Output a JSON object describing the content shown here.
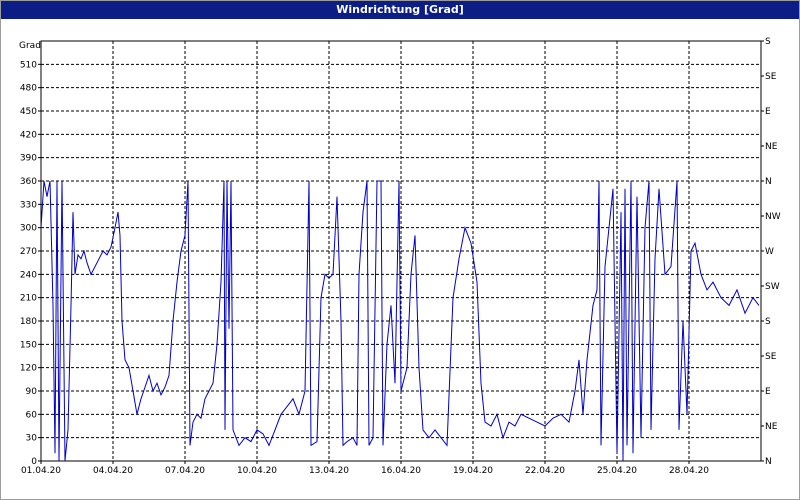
{
  "window": {
    "title": "Windrichtung [Grad]"
  },
  "chart_data": {
    "type": "line",
    "title": "Windrichtung [Grad]",
    "ylabel": "Grad",
    "ylim": [
      0,
      540
    ],
    "xlim": [
      "01.04.20",
      "01.05.20"
    ],
    "y_ticks": [
      0,
      30,
      60,
      90,
      120,
      150,
      180,
      210,
      240,
      270,
      300,
      330,
      360,
      390,
      420,
      450,
      480,
      510
    ],
    "x_ticks": [
      {
        "x": "01.04.20",
        "label": "01.04.20"
      },
      {
        "x": "04.04.20",
        "label": "04.04.20"
      },
      {
        "x": "07.04.20",
        "label": "07.04.20"
      },
      {
        "x": "10.04.20",
        "label": "10.04.20"
      },
      {
        "x": "13.04.20",
        "label": "13.04.20"
      },
      {
        "x": "16.04.20",
        "label": "16.04.20"
      },
      {
        "x": "19.04.20",
        "label": "19.04.20"
      },
      {
        "x": "22.04.20",
        "label": "22.04.20"
      },
      {
        "x": "25.04.20",
        "label": "25.04.20"
      },
      {
        "x": "28.04.20",
        "label": "28.04.20"
      }
    ],
    "right_axis": [
      {
        "y": 0,
        "label": "N"
      },
      {
        "y": 45,
        "label": "NE"
      },
      {
        "y": 90,
        "label": "E"
      },
      {
        "y": 135,
        "label": "SE"
      },
      {
        "y": 180,
        "label": "S"
      },
      {
        "y": 225,
        "label": "SW"
      },
      {
        "y": 270,
        "label": "W"
      },
      {
        "y": 315,
        "label": "NW"
      },
      {
        "y": 360,
        "label": "N"
      },
      {
        "y": 405,
        "label": "NE"
      },
      {
        "y": 450,
        "label": "E"
      },
      {
        "y": 495,
        "label": "SE"
      },
      {
        "y": 540,
        "label": "S"
      }
    ],
    "grid": true,
    "colors": {
      "line": "#0000cc",
      "grid": "#000000",
      "title_bar": "#0c1d86"
    },
    "series": [
      {
        "values": [
          [
            "01.04.20",
            300
          ],
          [
            "01.04.20 03:00",
            360
          ],
          [
            "01.04.20 06:00",
            340
          ],
          [
            "01.04.20 09:00",
            360
          ],
          [
            "01.04.20 12:00",
            200
          ],
          [
            "01.04.20 14:00",
            10
          ],
          [
            "01.04.20 16:00",
            360
          ],
          [
            "01.04.20 18:00",
            0
          ],
          [
            "01.04.20 21:00",
            360
          ],
          [
            "02.04.20",
            0
          ],
          [
            "02.04.20 03:00",
            40
          ],
          [
            "02.04.20 06:00",
            200
          ],
          [
            "02.04.20 08:00",
            320
          ],
          [
            "02.04.20 10:00",
            240
          ],
          [
            "02.04.20 13:00",
            265
          ],
          [
            "02.04.20 16:00",
            260
          ],
          [
            "02.04.20 19:00",
            270
          ],
          [
            "02.04.20 22:00",
            255
          ],
          [
            "03.04.20 02:00",
            240
          ],
          [
            "03.04.20 06:00",
            250
          ],
          [
            "03.04.20 10:00",
            260
          ],
          [
            "03.04.20 14:00",
            270
          ],
          [
            "03.04.20 18:00",
            265
          ],
          [
            "03.04.20 22:00",
            275
          ],
          [
            "04.04.20 02:00",
            300
          ],
          [
            "04.04.20 05:00",
            320
          ],
          [
            "04.04.20 07:00",
            290
          ],
          [
            "04.04.20 09:00",
            180
          ],
          [
            "04.04.20 12:00",
            130
          ],
          [
            "04.04.20 16:00",
            120
          ],
          [
            "04.04.20 20:00",
            90
          ],
          [
            "05.04.20",
            60
          ],
          [
            "05.04.20 04:00",
            80
          ],
          [
            "05.04.20 08:00",
            95
          ],
          [
            "05.04.20 12:00",
            110
          ],
          [
            "05.04.20 16:00",
            90
          ],
          [
            "05.04.20 20:00",
            100
          ],
          [
            "06.04.20",
            85
          ],
          [
            "06.04.20 04:00",
            95
          ],
          [
            "06.04.20 08:00",
            110
          ],
          [
            "06.04.20 12:00",
            180
          ],
          [
            "06.04.20 16:00",
            230
          ],
          [
            "06.04.20 20:00",
            270
          ],
          [
            "07.04.20",
            290
          ],
          [
            "07.04.20 03:00",
            360
          ],
          [
            "07.04.20 05:00",
            20
          ],
          [
            "07.04.20 08:00",
            50
          ],
          [
            "07.04.20 12:00",
            60
          ],
          [
            "07.04.20 16:00",
            55
          ],
          [
            "07.04.20 20:00",
            80
          ],
          [
            "08.04.20",
            90
          ],
          [
            "08.04.20 04:00",
            100
          ],
          [
            "08.04.20 08:00",
            150
          ],
          [
            "08.04.20 12:00",
            230
          ],
          [
            "08.04.20 15:00",
            360
          ],
          [
            "08.04.20 16:00",
            40
          ],
          [
            "08.04.20 18:00",
            360
          ],
          [
            "08.04.20 20:00",
            170
          ],
          [
            "08.04.20 22:00",
            360
          ],
          [
            "09.04.20",
            40
          ],
          [
            "09.04.20 06:00",
            20
          ],
          [
            "09.04.20 12:00",
            30
          ],
          [
            "09.04.20 18:00",
            25
          ],
          [
            "10.04.20",
            40
          ],
          [
            "10.04.20 06:00",
            35
          ],
          [
            "10.04.20 12:00",
            20
          ],
          [
            "10.04.20 18:00",
            40
          ],
          [
            "11.04.20",
            60
          ],
          [
            "11.04.20 06:00",
            70
          ],
          [
            "11.04.20 12:00",
            80
          ],
          [
            "11.04.20 18:00",
            60
          ],
          [
            "12.04.20",
            90
          ],
          [
            "12.04.20 04:00",
            360
          ],
          [
            "12.04.20 06:00",
            20
          ],
          [
            "12.04.20 12:00",
            25
          ],
          [
            "12.04.20 16:00",
            210
          ],
          [
            "12.04.20 20:00",
            240
          ],
          [
            "13.04.20",
            235
          ],
          [
            "13.04.20 04:00",
            240
          ],
          [
            "13.04.20 08:00",
            340
          ],
          [
            "13.04.20 12:00",
            180
          ],
          [
            "13.04.20 14:00",
            20
          ],
          [
            "13.04.20 18:00",
            25
          ],
          [
            "14.04.20",
            30
          ],
          [
            "14.04.20 04:00",
            20
          ],
          [
            "14.04.20 06:00",
            240
          ],
          [
            "14.04.20 10:00",
            320
          ],
          [
            "14.04.20 14:00",
            360
          ],
          [
            "14.04.20 16:00",
            20
          ],
          [
            "14.04.20 20:00",
            30
          ],
          [
            "15.04.20",
            360
          ],
          [
            "15.04.20 04:00",
            360
          ],
          [
            "15.04.20 06:00",
            20
          ],
          [
            "15.04.20 10:00",
            150
          ],
          [
            "15.04.20 14:00",
            200
          ],
          [
            "15.04.20 18:00",
            100
          ],
          [
            "15.04.20 22:00",
            360
          ],
          [
            "16.04.20",
            90
          ],
          [
            "16.04.20 06:00",
            120
          ],
          [
            "16.04.20 10:00",
            240
          ],
          [
            "16.04.20 14:00",
            290
          ],
          [
            "16.04.20 18:00",
            120
          ],
          [
            "16.04.20 22:00",
            40
          ],
          [
            "17.04.20 04:00",
            30
          ],
          [
            "17.04.20 10:00",
            40
          ],
          [
            "17.04.20 16:00",
            30
          ],
          [
            "17.04.20 22:00",
            20
          ],
          [
            "18.04.20 04:00",
            210
          ],
          [
            "18.04.20 10:00",
            260
          ],
          [
            "18.04.20 16:00",
            300
          ],
          [
            "18.04.20 22:00",
            280
          ],
          [
            "19.04.20 04:00",
            230
          ],
          [
            "19.04.20 08:00",
            100
          ],
          [
            "19.04.20 12:00",
            50
          ],
          [
            "19.04.20 18:00",
            45
          ],
          [
            "20.04.20",
            60
          ],
          [
            "20.04.20 06:00",
            30
          ],
          [
            "20.04.20 12:00",
            50
          ],
          [
            "20.04.20 18:00",
            45
          ],
          [
            "21.04.20",
            60
          ],
          [
            "21.04.20 08:00",
            55
          ],
          [
            "21.04.20 16:00",
            50
          ],
          [
            "22.04.20",
            45
          ],
          [
            "22.04.20 08:00",
            55
          ],
          [
            "22.04.20 16:00",
            60
          ],
          [
            "23.04.20",
            50
          ],
          [
            "23.04.20 06:00",
            90
          ],
          [
            "23.04.20 10:00",
            130
          ],
          [
            "23.04.20 14:00",
            60
          ],
          [
            "23.04.20 18:00",
            130
          ],
          [
            "24.04.20",
            200
          ],
          [
            "24.04.20 04:00",
            220
          ],
          [
            "24.04.20 06:00",
            360
          ],
          [
            "24.04.20 08:00",
            20
          ],
          [
            "24.04.20 12:00",
            250
          ],
          [
            "24.04.20 16:00",
            300
          ],
          [
            "24.04.20 20:00",
            350
          ],
          [
            "25.04.20",
            10
          ],
          [
            "25.04.20 04:00",
            320
          ],
          [
            "25.04.20 06:00",
            0
          ],
          [
            "25.04.20 08:00",
            350
          ],
          [
            "25.04.20 10:00",
            20
          ],
          [
            "25.04.20 14:00",
            360
          ],
          [
            "25.04.20 16:00",
            10
          ],
          [
            "25.04.20 20:00",
            340
          ],
          [
            "26.04.20",
            30
          ],
          [
            "26.04.20 04:00",
            300
          ],
          [
            "26.04.20 08:00",
            360
          ],
          [
            "26.04.20 10:00",
            40
          ],
          [
            "26.04.20 14:00",
            260
          ],
          [
            "26.04.20 18:00",
            350
          ],
          [
            "27.04.20",
            240
          ],
          [
            "27.04.20 06:00",
            250
          ],
          [
            "27.04.20 12:00",
            360
          ],
          [
            "27.04.20 14:00",
            40
          ],
          [
            "27.04.20 18:00",
            180
          ],
          [
            "27.04.20 22:00",
            60
          ],
          [
            "28.04.20 02:00",
            270
          ],
          [
            "28.04.20 06:00",
            280
          ],
          [
            "28.04.20 12:00",
            240
          ],
          [
            "28.04.20 18:00",
            220
          ],
          [
            "29.04.20",
            230
          ],
          [
            "29.04.20 08:00",
            210
          ],
          [
            "29.04.20 16:00",
            200
          ],
          [
            "30.04.20",
            220
          ],
          [
            "30.04.20 08:00",
            190
          ],
          [
            "30.04.20 16:00",
            210
          ],
          [
            "30.04.20 22:00",
            200
          ]
        ]
      }
    ]
  }
}
